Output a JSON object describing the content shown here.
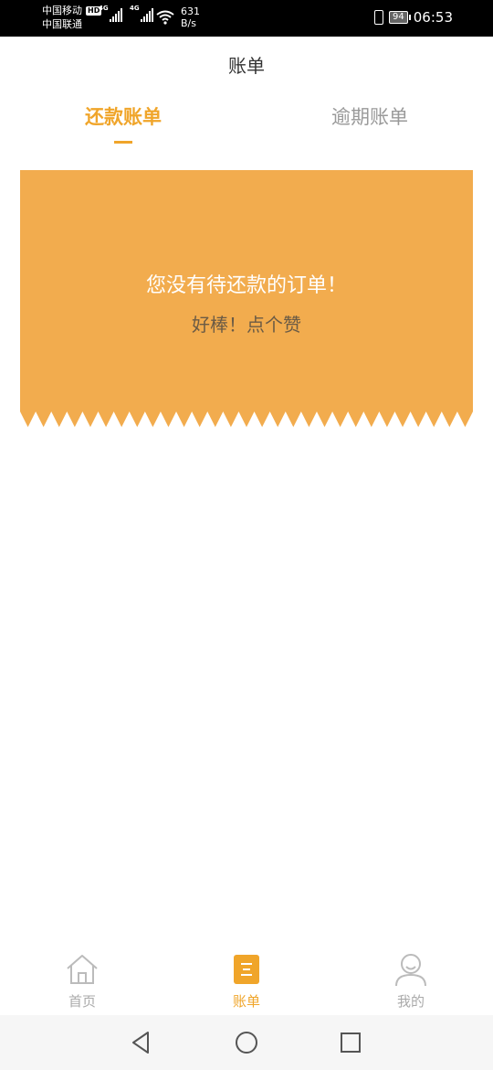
{
  "status_bar": {
    "carrier1": "中国移动",
    "hd": "HD",
    "carrier2": "中国联通",
    "net1": "4G",
    "net2": "4G",
    "speed_value": "631",
    "speed_unit": "B/s",
    "battery": "94",
    "time": "06:53"
  },
  "header": {
    "title": "账单"
  },
  "tabs": [
    {
      "label": "还款账单",
      "active": true
    },
    {
      "label": "逾期账单",
      "active": false
    }
  ],
  "empty_card": {
    "message": "您没有待还款的订单！",
    "sub_message": "好棒！点个赞",
    "color": "#F2AC4E"
  },
  "bottom_nav": [
    {
      "label": "首页",
      "icon": "home-icon"
    },
    {
      "label": "账单",
      "icon": "bill-icon",
      "active": true
    },
    {
      "label": "我的",
      "icon": "user-icon"
    }
  ],
  "accent_color": "#F0A52A"
}
